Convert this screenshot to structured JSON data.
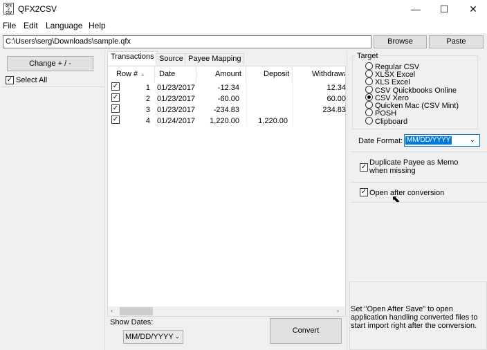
{
  "window": {
    "title": "QFX2CSV",
    "icon_text": "QFX\n2\nCSV"
  },
  "window_controls": {
    "minimize": "—",
    "maximize": "☐",
    "close": "✕"
  },
  "menu": [
    "File",
    "Edit",
    "Language",
    "Help"
  ],
  "path": {
    "value": "C:\\Users\\serg\\Downloads\\sample.qfx"
  },
  "buttons": {
    "browse": "Browse",
    "paste": "Paste",
    "change": "Change + / -",
    "convert": "Convert"
  },
  "left": {
    "select_all": "Select All"
  },
  "tabs": [
    "Transactions",
    "Source",
    "Payee Mapping"
  ],
  "grid": {
    "columns": [
      "Row #",
      "Date",
      "Amount",
      "Deposit",
      "Withdrawa"
    ],
    "rows": [
      {
        "row": "1",
        "date": "01/23/2017",
        "amount": "-12.34",
        "deposit": "",
        "withdrawal": "12.34"
      },
      {
        "row": "2",
        "date": "01/23/2017",
        "amount": "-60.00",
        "deposit": "",
        "withdrawal": "60.00"
      },
      {
        "row": "3",
        "date": "01/23/2017",
        "amount": "-234.83",
        "deposit": "",
        "withdrawal": "234.83"
      },
      {
        "row": "4",
        "date": "01/24/2017",
        "amount": "1,220.00",
        "deposit": "1,220.00",
        "withdrawal": ""
      }
    ]
  },
  "show_dates": {
    "label": "Show Dates:",
    "value": "MM/DD/YYYY"
  },
  "target": {
    "label": "Target",
    "options": [
      "Regular CSV",
      "XLSX Excel",
      "XLS Excel",
      "CSV Quickbooks Online",
      "CSV Xero",
      "Quicken Mac (CSV Mint)",
      "POSH",
      "Clipboard"
    ],
    "selected": "CSV Xero"
  },
  "date_format": {
    "label": "Date Format:",
    "value": "MM/DD/YYYY"
  },
  "options": {
    "duplicate_payee": "Duplicate Payee as Memo when missing",
    "open_after": "Open after conversion"
  },
  "help_text": "Set \"Open After Save\" to open application handling converted files to start import right after the conversion.",
  "colors": {
    "accent": "#0078d7",
    "button_face": "#e1e1e1",
    "background": "#f0f0f0"
  }
}
